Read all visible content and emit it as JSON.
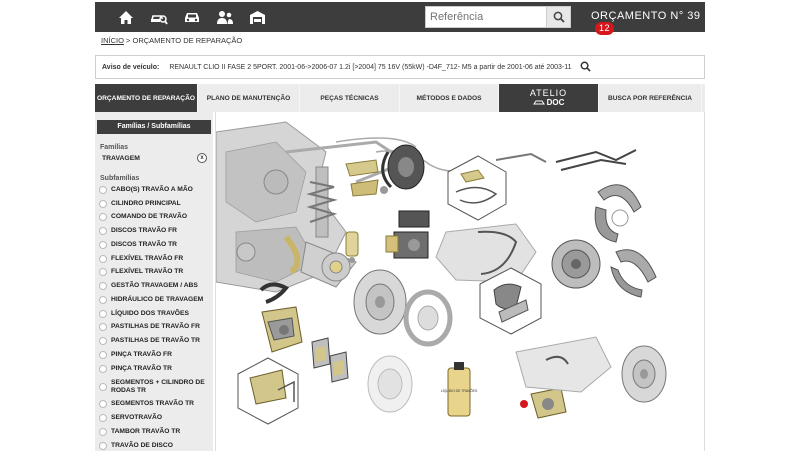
{
  "topbar": {
    "icons": [
      "home-icon",
      "car-search-icon",
      "car-icon",
      "users-icon",
      "garage-icon"
    ],
    "search_placeholder": "Referência",
    "orcamento_label": "ORÇAMENTO",
    "orcamento_number": "N° 39",
    "orcamento_badge": "12"
  },
  "breadcrumb": {
    "home": "INÍCIO",
    "separator": ">",
    "current": "ORÇAMENTO DE REPARAÇÃO"
  },
  "vehicle": {
    "label": "Aviso de veículo:",
    "description": "RENAULT CLIO II FASE 2 5PORT. 2001-06->2006-07 1.2i [>2004] 75 16V (55kW) -D4F_712- M5 a partir de 2001-06 até 2003-11"
  },
  "tabs": [
    {
      "label": "ORÇAMENTO DE REPARAÇÃO",
      "active": true
    },
    {
      "label": "PLANO DE MANUTENÇÃO",
      "active": false
    },
    {
      "label": "PEÇAS TÉCNICAS",
      "active": false
    },
    {
      "label": "MÉTODOS E DADOS",
      "active": false
    },
    {
      "label": "BUSCA POR REFERÊNCIA",
      "active": false
    }
  ],
  "logo": {
    "line1": "ATELIO",
    "line2": "DOC"
  },
  "sidebar": {
    "header": "Famílias / Subfamílias",
    "families_label": "Famílias",
    "family_selected": "TRAVAGEM",
    "clear": "x",
    "subfamilies_label": "Subfamílias",
    "subfamilies": [
      "CABO(S) TRAVÃO A MÃO",
      "CILINDRO PRINCIPAL",
      "COMANDO DE TRAVÃO",
      "DISCOS TRAVÃO FR",
      "DISCOS TRAVÃO TR",
      "FLEXÍVEL TRAVÃO FR",
      "FLEXÍVEL TRAVÃO TR",
      "GESTÃO TRAVAGEM / ABS",
      "HIDRÁULICO DE TRAVAGEM",
      "LÍQUIDO DOS TRAVÕES",
      "PASTILHAS DE TRAVÃO FR",
      "PASTILHAS DE TRAVÃO TR",
      "PINÇA TRAVÃO FR",
      "PINÇA TRAVÃO TR",
      "SEGMENTOS + CILINDRO DE RODAS TR",
      "SEGMENTOS TRAVÃO TR",
      "SERVOTRAVÃO",
      "TAMBOR TRAVÃO TR",
      "TRAVÃO DE DISCO"
    ]
  },
  "diagram": {
    "fluid_can_text": "LÍQUIDO DE TRAVÕES"
  }
}
